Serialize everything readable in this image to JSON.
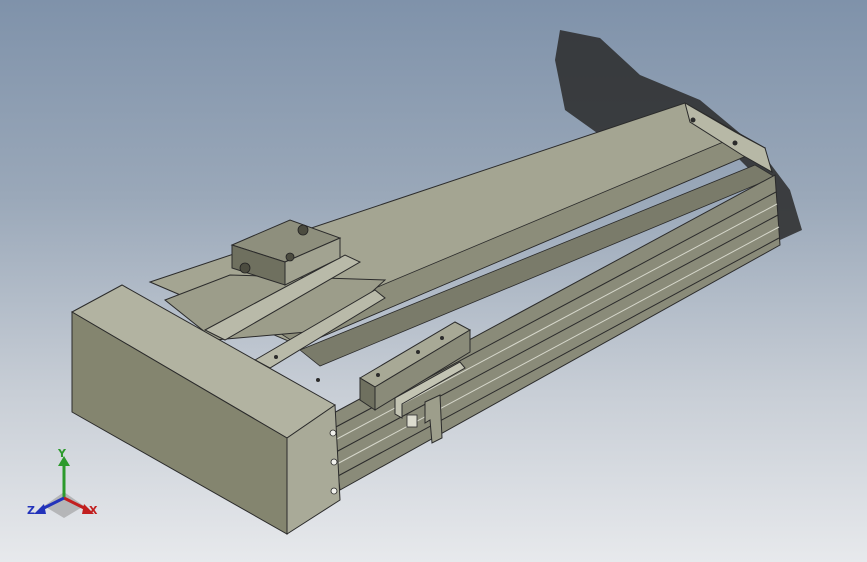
{
  "view": {
    "background_top": "#7f92aa",
    "background_bottom": "#e7e9ec",
    "model": "linear-actuator-module"
  },
  "triad": {
    "x_label": "X",
    "y_label": "Y",
    "z_label": "Z",
    "x_color": "#c21f1f",
    "y_color": "#2c9a2c",
    "z_color": "#2233bb"
  }
}
